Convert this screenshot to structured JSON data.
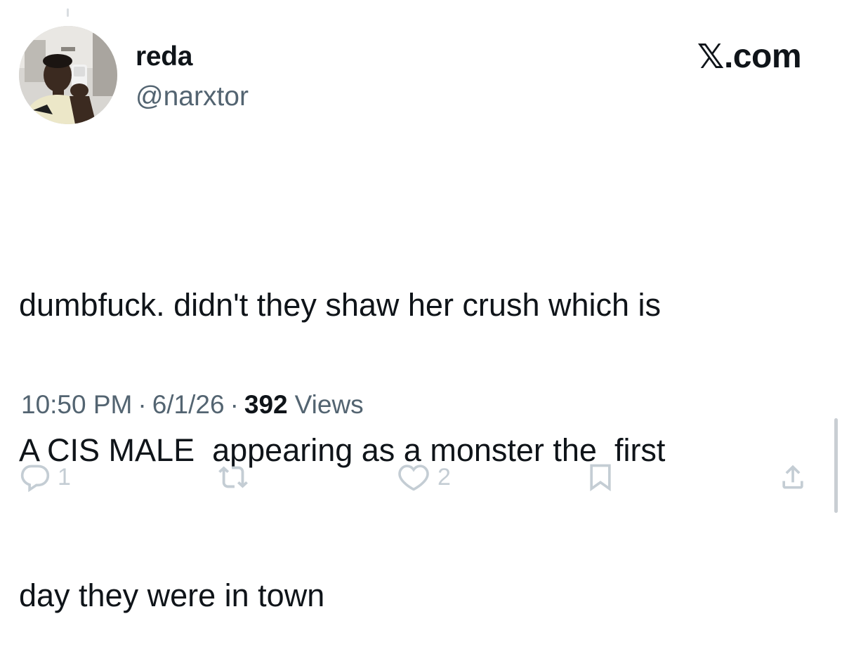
{
  "author": {
    "display_name": "reda",
    "handle": "@narxtor",
    "avatar_icon": "profile-photo"
  },
  "brand": {
    "label": ".com",
    "mark": "𝕏"
  },
  "tweet": {
    "lines": [
      "dumbfuck. didn't they shaw her crush which is",
      "A CIS MALE  appearing as a monster the  first",
      "day they were in town"
    ]
  },
  "meta": {
    "time": "10:50 PM",
    "separator": "·",
    "date": "6/1/26",
    "views_count": "392",
    "views_label": "Views"
  },
  "actions": {
    "reply_count": "1",
    "retweet_count": "",
    "like_count": "2",
    "icons": [
      "reply-icon",
      "retweet-icon",
      "like-icon",
      "bookmark-icon",
      "share-icon"
    ]
  },
  "colors": {
    "text_primary": "#0f1419",
    "text_secondary": "#536471",
    "action_icon": "#c4cdd4"
  }
}
